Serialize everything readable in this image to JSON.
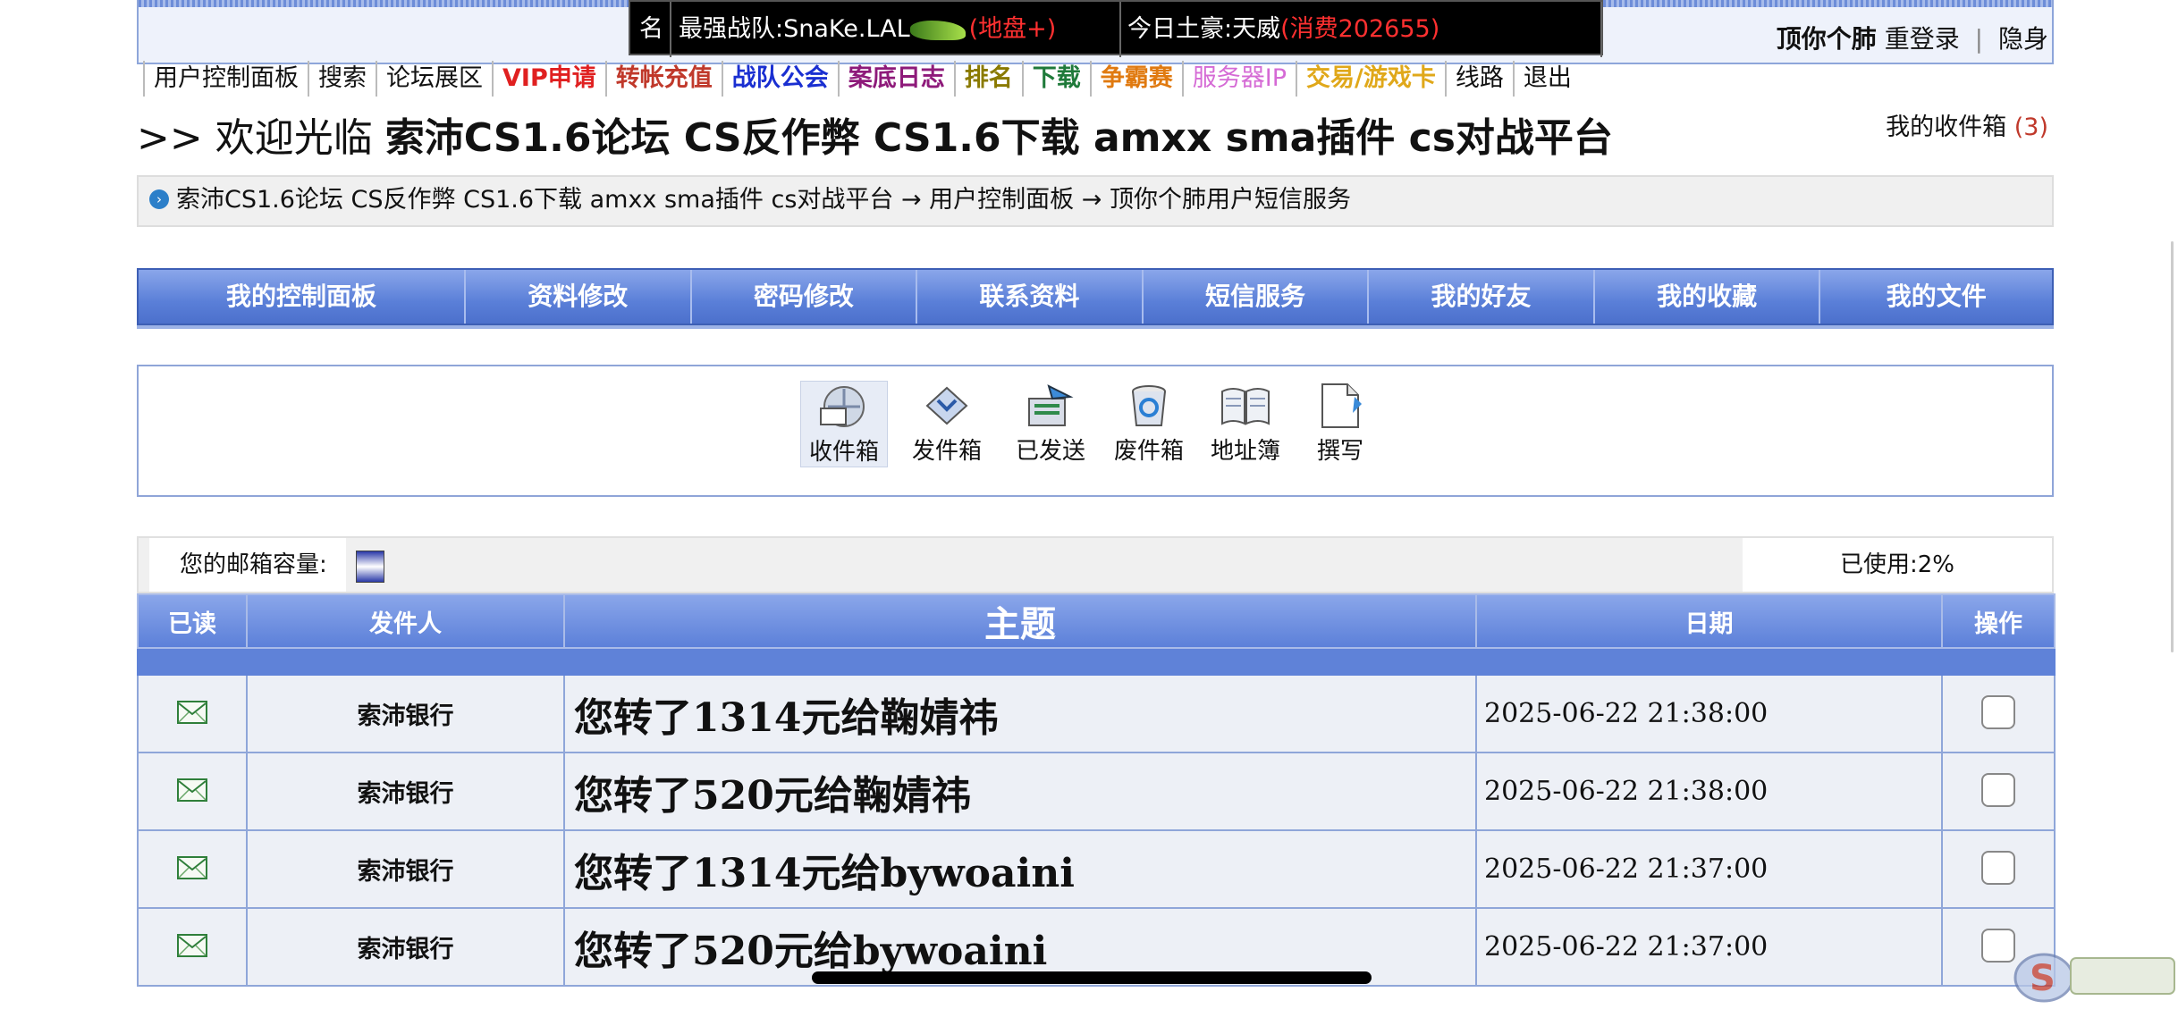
{
  "news": {
    "label": "名",
    "team": "最强战队:SnaKe.LAL",
    "team_tag": "(地盘+)",
    "rich": "今日土豪:天威",
    "rich_tag": "(消费202655)"
  },
  "user_links": {
    "username": "顶你个肺",
    "relogin": "重登录",
    "sep": "|",
    "hide": "隐身"
  },
  "nav": [
    {
      "label": "用户控制面板",
      "color": "#111111",
      "bold": false
    },
    {
      "label": "搜索",
      "color": "#111111",
      "bold": false
    },
    {
      "label": "论坛展区",
      "color": "#111111",
      "bold": false
    },
    {
      "label": "VIP申请",
      "color": "#e02020",
      "bold": true
    },
    {
      "label": "转帐充值",
      "color": "#c0392b",
      "bold": true
    },
    {
      "label": "战队公会",
      "color": "#1a2fd1",
      "bold": true
    },
    {
      "label": "案底日志",
      "color": "#8e1a7a",
      "bold": true
    },
    {
      "label": "排名",
      "color": "#8a7a00",
      "bold": true
    },
    {
      "label": "下载",
      "color": "#1f7a3a",
      "bold": true
    },
    {
      "label": "争霸赛",
      "color": "#e07a10",
      "bold": true
    },
    {
      "label": "服务器IP",
      "color": "#d56ad5",
      "bold": false
    },
    {
      "label": "交易/游戏卡",
      "color": "#e0a81a",
      "bold": true
    },
    {
      "label": "线路",
      "color": "#111111",
      "bold": false
    },
    {
      "label": "退出",
      "color": "#111111",
      "bold": false
    }
  ],
  "welcome": {
    "prefix": ">> 欢迎光临 ",
    "site": "索沛CS1.6论坛 CS反作弊 CS1.6下载 amxx sma插件 cs对战平台"
  },
  "inbox_link": {
    "label": "我的收件箱",
    "count": "(3)"
  },
  "breadcrumb": "索沛CS1.6论坛 CS反作弊 CS1.6下载 amxx sma插件 cs对战平台 → 用户控制面板 → 顶你个肺用户短信服务",
  "menu": [
    "我的控制面板",
    "资料修改",
    "密码修改",
    "联系资料",
    "短信服务",
    "我的好友",
    "我的收藏",
    "我的文件"
  ],
  "mail_buttons": [
    {
      "label": "收件箱",
      "icon": "inbox-icon"
    },
    {
      "label": "发件箱",
      "icon": "outbox-icon"
    },
    {
      "label": "已发送",
      "icon": "sent-icon"
    },
    {
      "label": "废件箱",
      "icon": "trash-icon"
    },
    {
      "label": "地址簿",
      "icon": "address-book-icon"
    },
    {
      "label": "撰写",
      "icon": "compose-icon"
    }
  ],
  "capacity": {
    "label": "您的邮箱容量:",
    "used": "已使用:2%"
  },
  "table": {
    "headers": {
      "read": "已读",
      "sender": "发件人",
      "subject": "主题",
      "date": "日期",
      "action": "操作"
    },
    "rows": [
      {
        "sender": "索沛银行",
        "subject": "您转了1314元给鞠婧祎",
        "date": "2025-06-22 21:38:00"
      },
      {
        "sender": "索沛银行",
        "subject": "您转了520元给鞠婧祎",
        "date": "2025-06-22 21:38:00"
      },
      {
        "sender": "索沛银行",
        "subject": "您转了1314元给bywoaini",
        "date": "2025-06-22 21:37:00"
      },
      {
        "sender": "索沛银行",
        "subject": "您转了520元给bywoaini",
        "date": "2025-06-22 21:37:00"
      }
    ]
  },
  "colors": {
    "menu_blue": "#5a7fd8",
    "border_blue": "#8fa6d9",
    "row_bg": "#edf0f6"
  }
}
